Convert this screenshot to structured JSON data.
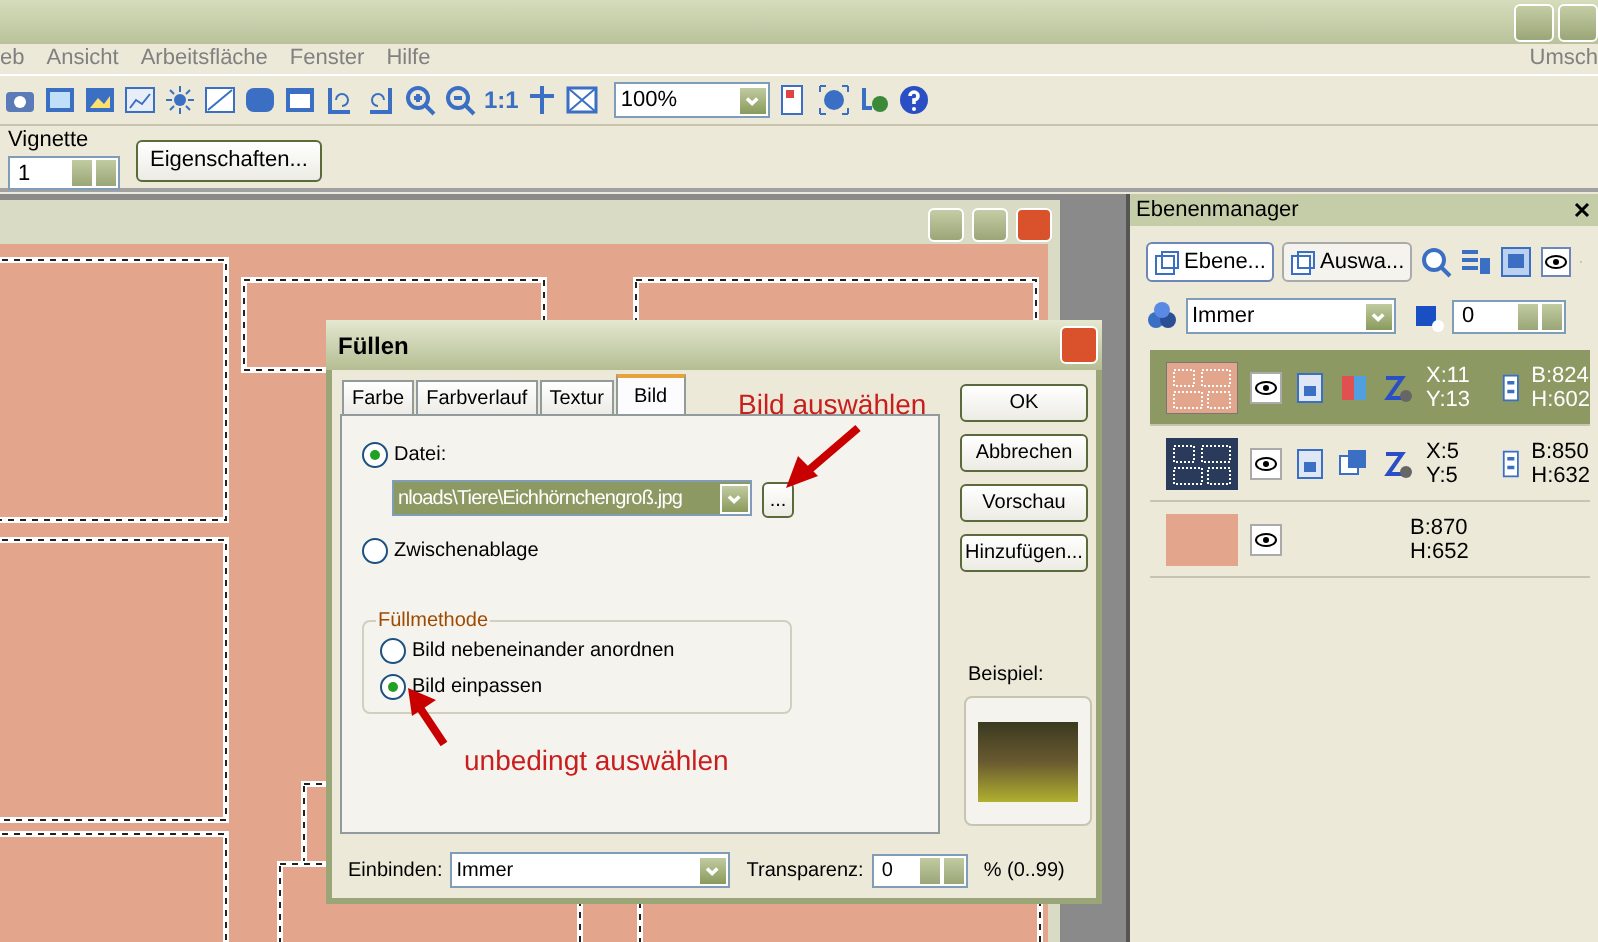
{
  "menu": [
    "eb",
    "Ansicht",
    "Arbeitsfläche",
    "Fenster",
    "Hilfe"
  ],
  "menu_right": "Umsch",
  "toolbar": {
    "actual_size_label": "1:1",
    "zoom_value": "100%"
  },
  "property_bar": {
    "vignette_label": "Vignette",
    "vignette_value": "1",
    "properties_button": "Eigenschaften..."
  },
  "dialog": {
    "title": "Füllen",
    "tabs": [
      {
        "label": "Farbe",
        "selected": false
      },
      {
        "label": "Farbverlauf",
        "selected": false
      },
      {
        "label": "Textur",
        "selected": false
      },
      {
        "label": "Bild",
        "selected": true
      }
    ],
    "source_options": [
      {
        "label": "Datei:",
        "selected": true
      },
      {
        "label": "Zwischenablage",
        "selected": false
      }
    ],
    "file_path": "nloads\\Tiere\\Eichhörnchengroß.jpg",
    "browse_button": "...",
    "fill_method": {
      "legend": "Füllmethode",
      "options": [
        {
          "label": "Bild nebeneinander anordnen",
          "selected": false
        },
        {
          "label": "Bild einpassen",
          "selected": true
        }
      ]
    },
    "buttons": [
      "OK",
      "Abbrechen",
      "Vorschau",
      "Hinzufügen..."
    ],
    "preview_label": "Beispiel:",
    "blend_label": "Einbinden:",
    "blend_value": "Immer",
    "transparency_label": "Transparenz:",
    "transparency_value": "0",
    "transparency_range": "% (0..99)"
  },
  "annotations": [
    {
      "text": "Bild auswählen"
    },
    {
      "text": "unbedingt auswählen"
    }
  ],
  "layer_manager": {
    "title": "Ebenenmanager",
    "tabs": [
      {
        "label": "Ebene...",
        "selected": true
      },
      {
        "label": "Auswa...",
        "selected": false
      }
    ],
    "blend_value": "Immer",
    "opacity_value": "0",
    "layers": [
      {
        "kind": "tiles",
        "selected": true,
        "x": "X:11",
        "y": "Y:13",
        "b": "B:824",
        "h": "H:602"
      },
      {
        "kind": "frames",
        "selected": false,
        "x": "X:5",
        "y": "Y:5",
        "b": "B:850",
        "h": "H:632"
      },
      {
        "kind": "background",
        "selected": false,
        "b": "B:870",
        "h": "H:652"
      }
    ]
  }
}
